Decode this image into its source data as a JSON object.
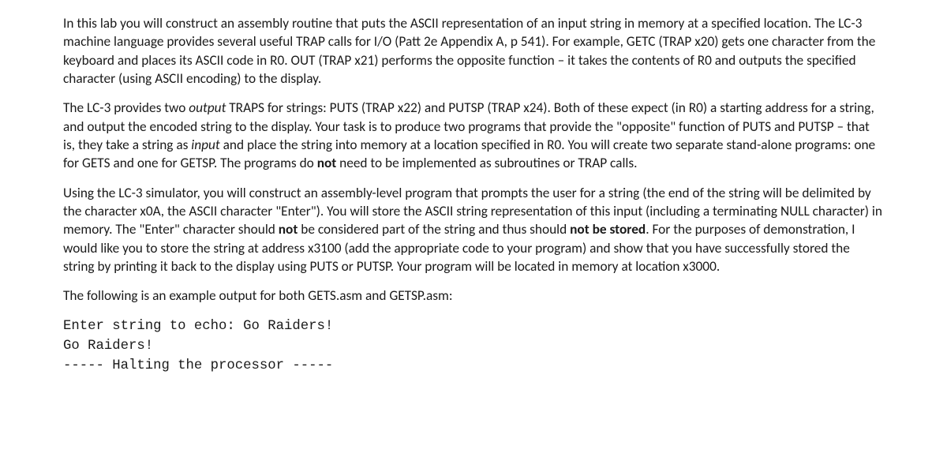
{
  "para1": {
    "t1": "In this lab you will construct an assembly routine that puts the ASCII representation of an input string in memory at a specified location.  The LC-3 machine language provides several useful TRAP calls for I/O (Patt 2e Appendix A, p 541).  For example, GETC (TRAP x20) gets one character from the keyboard and places its ASCII code in R0.  OUT (TRAP x21) performs the opposite function – it takes the contents of R0 and outputs the specified character (using ASCII encoding) to the display."
  },
  "para2": {
    "t1": "The LC-3 provides two ",
    "t2": "output",
    "t3": " TRAPS for strings:  PUTS (TRAP x22) and PUTSP (TRAP x24).  Both of these expect (in R0) a starting address for a string, and output the encoded string to the display.  Your task is to produce two programs that provide the \"opposite\" function of PUTS and PUTSP – that is, they take a string as ",
    "t4": "input",
    "t5": " and place the string into memory at a location specified in R0.  You will create two separate stand-alone programs:  one for GETS and one for GETSP.  The programs do ",
    "t6": "not",
    "t7": " need to be implemented as subroutines or TRAP calls."
  },
  "para3": {
    "t1": "Using the LC-3 simulator, you will construct an assembly-level program that prompts the user for a string (the end of the string will be delimited by the character x0A, the ASCII character \"Enter\").  You will store the ASCII string representation of this input (including a terminating NULL character) in memory.  The \"Enter\" character should ",
    "t2": "not",
    "t3": " be considered part of the string and thus should ",
    "t4": "not be stored",
    "t5": ". For the purposes of demonstration, I would like you to store the string at address x3100 (add the appropriate code to your program) and show that you have successfully stored the string by printing it back to the display using PUTS or PUTSP.  Your program will be located in memory at location x3000."
  },
  "para4": {
    "t1": "The following is an example output for both GETS.asm and GETSP.asm:"
  },
  "output": {
    "line1": "Enter string to echo: Go Raiders!",
    "line2": "Go Raiders!",
    "line3": "----- Halting the processor -----"
  }
}
